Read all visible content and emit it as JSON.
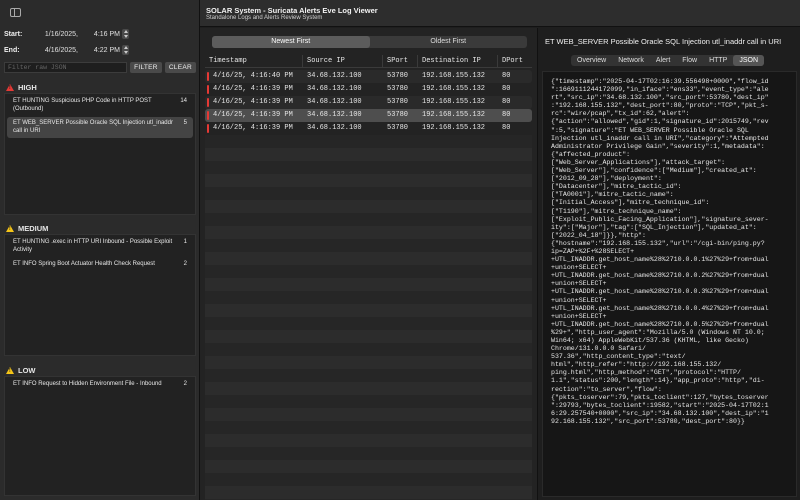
{
  "sidebar": {
    "start_label": "Start:",
    "start_date": "1/16/2025,",
    "start_time": "4:16 PM",
    "end_label": "End:",
    "end_date": "4/16/2025,",
    "end_time": "4:22 PM",
    "filter_placeholder": "Filter raw JSON",
    "filter_button": "FILTER",
    "clear_button": "CLEAR",
    "high": {
      "label": "HIGH",
      "items": [
        {
          "title": "ET HUNTING Suspicious PHP Code in HTTP POST (Outbound)",
          "count": "14"
        },
        {
          "title": "ET WEB_SERVER Possible Oracle SQL Injection utl_inaddr call in URI",
          "count": "5"
        }
      ]
    },
    "medium": {
      "label": "MEDIUM",
      "items": [
        {
          "title": "ET HUNTING .exec in HTTP URI Inbound - Possible Exploit Activity",
          "count": "1"
        },
        {
          "title": "ET INFO Spring Boot Actuator Health Check Request",
          "count": "2"
        }
      ]
    },
    "low": {
      "label": "LOW",
      "items": [
        {
          "title": "ET INFO Request to Hidden Environment File - Inbound",
          "count": "2"
        }
      ]
    },
    "severity_colors": {
      "high": "#e53935",
      "medium": "#f5c518",
      "low": "#f5c518"
    }
  },
  "header": {
    "title": "SOLAR System - Suricata Alerts Eve Log Viewer",
    "subtitle": "Standalone Logs and Alerts Review System"
  },
  "table": {
    "sort_options": [
      "Newest First",
      "Oldest First"
    ],
    "sort_selected": "Newest First",
    "columns": [
      "Timestamp",
      "Source IP",
      "SPort",
      "Destination IP",
      "DPort"
    ],
    "rows": [
      [
        "4/16/25, 4:16:40 PM",
        "34.68.132.100",
        "53780",
        "192.168.155.132",
        "80"
      ],
      [
        "4/16/25, 4:16:39 PM",
        "34.68.132.100",
        "53780",
        "192.168.155.132",
        "80"
      ],
      [
        "4/16/25, 4:16:39 PM",
        "34.68.132.100",
        "53780",
        "192.168.155.132",
        "80"
      ],
      [
        "4/16/25, 4:16:39 PM",
        "34.68.132.100",
        "53780",
        "192.168.155.132",
        "80"
      ],
      [
        "4/16/25, 4:16:39 PM",
        "34.68.132.100",
        "53780",
        "192.168.155.132",
        "80"
      ]
    ],
    "selected_row": 3
  },
  "detail": {
    "title": "ET WEB_SERVER Possible Oracle SQL Injection utl_inaddr call in URI",
    "tabs": [
      "Overview",
      "Network",
      "Alert",
      "Flow",
      "HTTP",
      "JSON"
    ],
    "active_tab": "JSON",
    "json_lines": [
      "{\"timestamp\":\"2025-04-17T02:16:39.556498+0000\",\"flow_id",
      "\":1669111244172099,\"in_iface\":\"ens33\",\"event_type\":\"ale",
      "rt\",\"src_ip\":\"34.68.132.100\",\"src_port\":53780,\"dest_ip\"",
      ":\"192.168.155.132\",\"dest_port\":80,\"proto\":\"TCP\",\"pkt_s-",
      "rc\":\"wire/pcap\",\"tx_id\":62,\"alert\":",
      "{\"action\":\"allowed\",\"gid\":1,\"signature_id\":2015749,\"rev",
      "\":5,\"signature\":\"ET WEB_SERVER Possible Oracle SQL",
      "Injection utl_inaddr call in URI\",\"category\":\"Attempted",
      "Administrator Privilege Gain\",\"severity\":1,\"metadata\":",
      "{\"affected_product\":",
      "[\"Web_Server_Applications\"],\"attack_target\":",
      "[\"Web_Server\"],\"confidence\":[\"Medium\"],\"created_at\":",
      "[\"2012_09_28\"],\"deployment\":",
      "[\"Datacenter\"],\"mitre_tactic_id\":",
      "[\"TA0001\"],\"mitre_tactic_name\":",
      "[\"Initial_Access\"],\"mitre_technique_id\":",
      "[\"T1190\"],\"mitre_technique_name\":",
      "[\"Exploit_Public_Facing_Application\"],\"signature_sever-",
      "ity\":[\"Major\"],\"tag\":[\"SQL_Injection\"],\"updated_at\":",
      "[\"2022_04_18\"]}},\"http\":",
      "{\"hostname\":\"192.168.155.132\",\"url\":\"/cgi-bin/ping.py?",
      "ip=ZAP+%2F+%28SELECT+",
      "+UTL_INADDR.get_host_name%28%2710.0.0.1%27%29+from+dual",
      "+union+SELECT+",
      "+UTL_INADDR.get_host_name%28%2710.0.0.2%27%29+from+dual",
      "+union+SELECT+",
      "+UTL_INADDR.get_host_name%28%2710.0.0.3%27%29+from+dual",
      "+union+SELECT+",
      "+UTL_INADDR.get_host_name%28%2710.0.0.4%27%29+from+dual",
      "+union+SELECT+",
      "+UTL_INADDR.get_host_name%28%2710.0.0.5%27%29+from+dual",
      "%29+\",\"http_user_agent\":\"Mozilla/5.0 (Windows NT 10.0;",
      "Win64; x64) AppleWebKit/537.36 (KHTML, like Gecko)",
      "Chrome/131.0.0.0 Safari/",
      "537.36\",\"http_content_type\":\"text/",
      "html\",\"http_refer\":\"http://192.168.155.132/",
      "ping.html\",\"http_method\":\"GET\",\"protocol\":\"HTTP/",
      "1.1\",\"status\":200,\"length\":14},\"app_proto\":\"http\",\"di-",
      "rection\":\"to_server\",\"flow\":",
      "{\"pkts_toserver\":79,\"pkts_toclient\":127,\"bytes_toserver",
      "\":29793,\"bytes_toclient\":19582,\"start\":\"2025-04-17T02:1",
      "6:29.257540+0000\",\"src_ip\":\"34.68.132.100\",\"dest_ip\":\"1",
      "92.168.155.132\",\"src_port\":53780,\"dest_port\":80}}"
    ]
  }
}
